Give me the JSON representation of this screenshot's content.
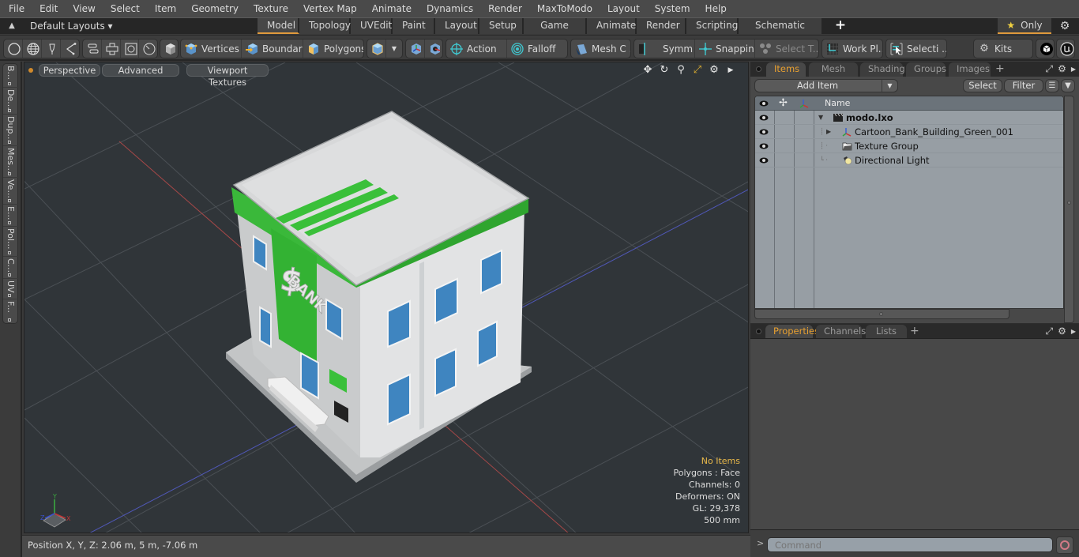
{
  "menubar": {
    "items": [
      "File",
      "Edit",
      "View",
      "Select",
      "Item",
      "Geometry",
      "Texture",
      "Vertex Map",
      "Animate",
      "Dynamics",
      "Render",
      "MaxToModo",
      "Layout",
      "System",
      "Help"
    ]
  },
  "layoutbar": {
    "layout_select": "Default Layouts ▾",
    "tabs": [
      "Model",
      "Topology",
      "UVEdit",
      "Paint",
      "Layout",
      "Setup",
      "Game Tools",
      "Animate",
      "Render",
      "Scripting",
      "Schematic Fusion"
    ],
    "active_tab": "Model",
    "add_tab": "+",
    "only_label": "Only",
    "accent_color": "#e09a3c"
  },
  "toolbar": {
    "vertices": "Vertices",
    "boundary": "Boundary",
    "polygons": "Polygons",
    "action": "Action",
    "action_more": "...",
    "falloff": "Falloff",
    "mesh_c": "Mesh C ...",
    "symm": "Symm ...",
    "snapping": "Snapping",
    "select_t": "Select T...",
    "work_pl": "Work Pl...",
    "selecti": "Selecti ...",
    "kits": "Kits"
  },
  "left_tabs": [
    "B...",
    "De...",
    "Dup...",
    "Mes...",
    "Ve...",
    "E...",
    "Pol...",
    "C...",
    "UV",
    "F..."
  ],
  "viewport": {
    "view_mode": "Perspective",
    "shading": "Advanced",
    "textures": "Viewport Textures",
    "info": {
      "selection": "No Items",
      "polygons": "Polygons : Face",
      "channels": "Channels: 0",
      "deformers": "Deformers: ON",
      "gl": "GL: 29,378",
      "grid": "500 mm"
    },
    "model_sign": "BANK",
    "model_symbol": "$",
    "axis": {
      "x": "X",
      "y": "Y",
      "z": "Z"
    }
  },
  "status": {
    "position": "Position X, Y, Z:   2.06 m, 5 m, -7.06 m"
  },
  "items_panel": {
    "tabs": [
      "Items",
      "Mesh Ops",
      "Shading",
      "Groups",
      "Images"
    ],
    "active_tab": "Items",
    "add_item": "Add Item",
    "select": "Select",
    "filter": "Filter",
    "column_name": "Name",
    "rows": [
      {
        "name": "modo.lxo",
        "icon": "scene-icon",
        "bold": true
      },
      {
        "name": "Cartoon_Bank_Building_Green_001",
        "icon": "mesh-locator-icon",
        "bold": false
      },
      {
        "name": "Texture Group",
        "icon": "texture-group-icon",
        "bold": false
      },
      {
        "name": "Directional Light",
        "icon": "directional-light-icon",
        "bold": false
      }
    ]
  },
  "properties_panel": {
    "tabs": [
      "Properties",
      "Channels",
      "Lists"
    ],
    "active_tab": "Properties"
  },
  "command": {
    "prompt": ">",
    "placeholder": "Command"
  }
}
